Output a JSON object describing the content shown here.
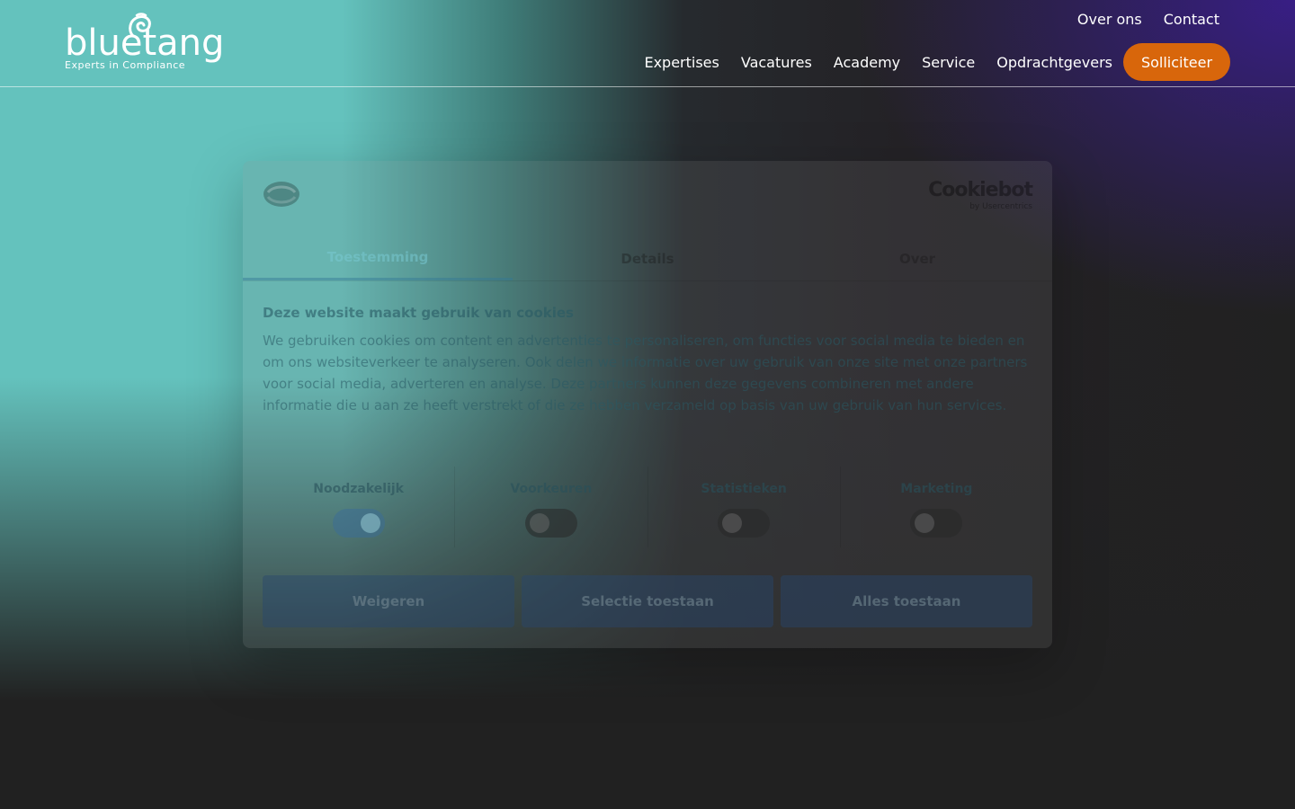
{
  "header": {
    "logo": {
      "word": "bluetang",
      "tagline": "Experts in Compliance"
    },
    "top_links": [
      "Over ons",
      "Contact"
    ],
    "nav_items": [
      "Expertises",
      "Vacatures",
      "Academy",
      "Service",
      "Opdrachtgevers"
    ],
    "cta_label": "Solliciteer"
  },
  "cookie_dialog": {
    "brand": {
      "name": "Cookiebot",
      "sub": "by Usercentrics"
    },
    "tabs": [
      "Toestemming",
      "Details",
      "Over"
    ],
    "active_tab": "Toestemming",
    "title": "Deze website maakt gebruik van cookies",
    "body": "We gebruiken cookies om content en advertenties te personaliseren, om functies voor social media te bieden en om ons websiteverkeer te analyseren. Ook delen we informatie over uw gebruik van onze site met onze partners voor social media, adverteren en analyse. Deze partners kunnen deze gegevens combineren met andere informatie die u aan ze heeft verstrekt of die ze hebben verzameld op basis van uw gebruik van hun services.",
    "toggles": [
      {
        "label": "Noodzakelijk",
        "on": true
      },
      {
        "label": "Voorkeuren",
        "on": false
      },
      {
        "label": "Statistieken",
        "on": false
      },
      {
        "label": "Marketing",
        "on": false
      }
    ],
    "buttons": [
      "Weigeren",
      "Selectie toestaan",
      "Alles toestaan"
    ]
  },
  "colors": {
    "teal": "#64c2bd",
    "purple": "#3c1e96",
    "dark": "#212121",
    "cta": "#d8660b"
  }
}
